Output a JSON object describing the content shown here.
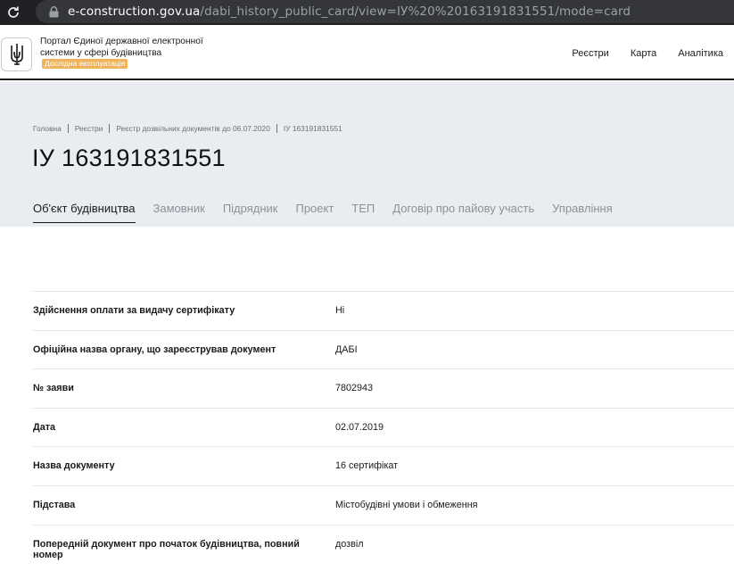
{
  "browser": {
    "url_host": "e-construction.gov.ua",
    "url_path": "/dabi_history_public_card/view=IУ%20%20163191831551/mode=card"
  },
  "header": {
    "portal_title": "Портал Єдиної державної електронної системи у сфері будівництва",
    "badge": "Дослідна експлуатація",
    "nav": [
      "Реєстри",
      "Карта",
      "Аналітика"
    ]
  },
  "breadcrumb": [
    "Головна",
    "Реєстри",
    "Реєстр дозвільних документів до 06.07.2020",
    "IУ 163191831551"
  ],
  "page": {
    "title": "IУ 163191831551"
  },
  "tabs": [
    {
      "label": "Об'єкт будівництва",
      "active": true
    },
    {
      "label": "Замовник",
      "active": false
    },
    {
      "label": "Підрядник",
      "active": false
    },
    {
      "label": "Проект",
      "active": false
    },
    {
      "label": "ТЕП",
      "active": false
    },
    {
      "label": "Договір про пайову участь",
      "active": false
    },
    {
      "label": "Управління",
      "active": false
    }
  ],
  "details": [
    {
      "label": "Здійснення оплати за видачу сертифікату",
      "value": "Ні"
    },
    {
      "label": "Офіційна назва органу, що зареєстрував документ",
      "value": "ДАБІ"
    },
    {
      "label": "№ заяви",
      "value": "7802943"
    },
    {
      "label": "Дата",
      "value": "02.07.2019"
    },
    {
      "label": "Назва документу",
      "value": "16 сертифікат"
    },
    {
      "label": "Підстава",
      "value": "Містобудівні умови і обмеження"
    },
    {
      "label": "Попередній документ про початок будівництва, повний номер",
      "value": "дозвіл"
    }
  ],
  "colors": {
    "hero_bg": "#e9edf1",
    "badge": "#f0b25a",
    "browser_bar": "#202124"
  },
  "icons": {
    "reload": "reload-icon",
    "lock": "lock-icon",
    "emblem": "trident-emblem-icon"
  }
}
